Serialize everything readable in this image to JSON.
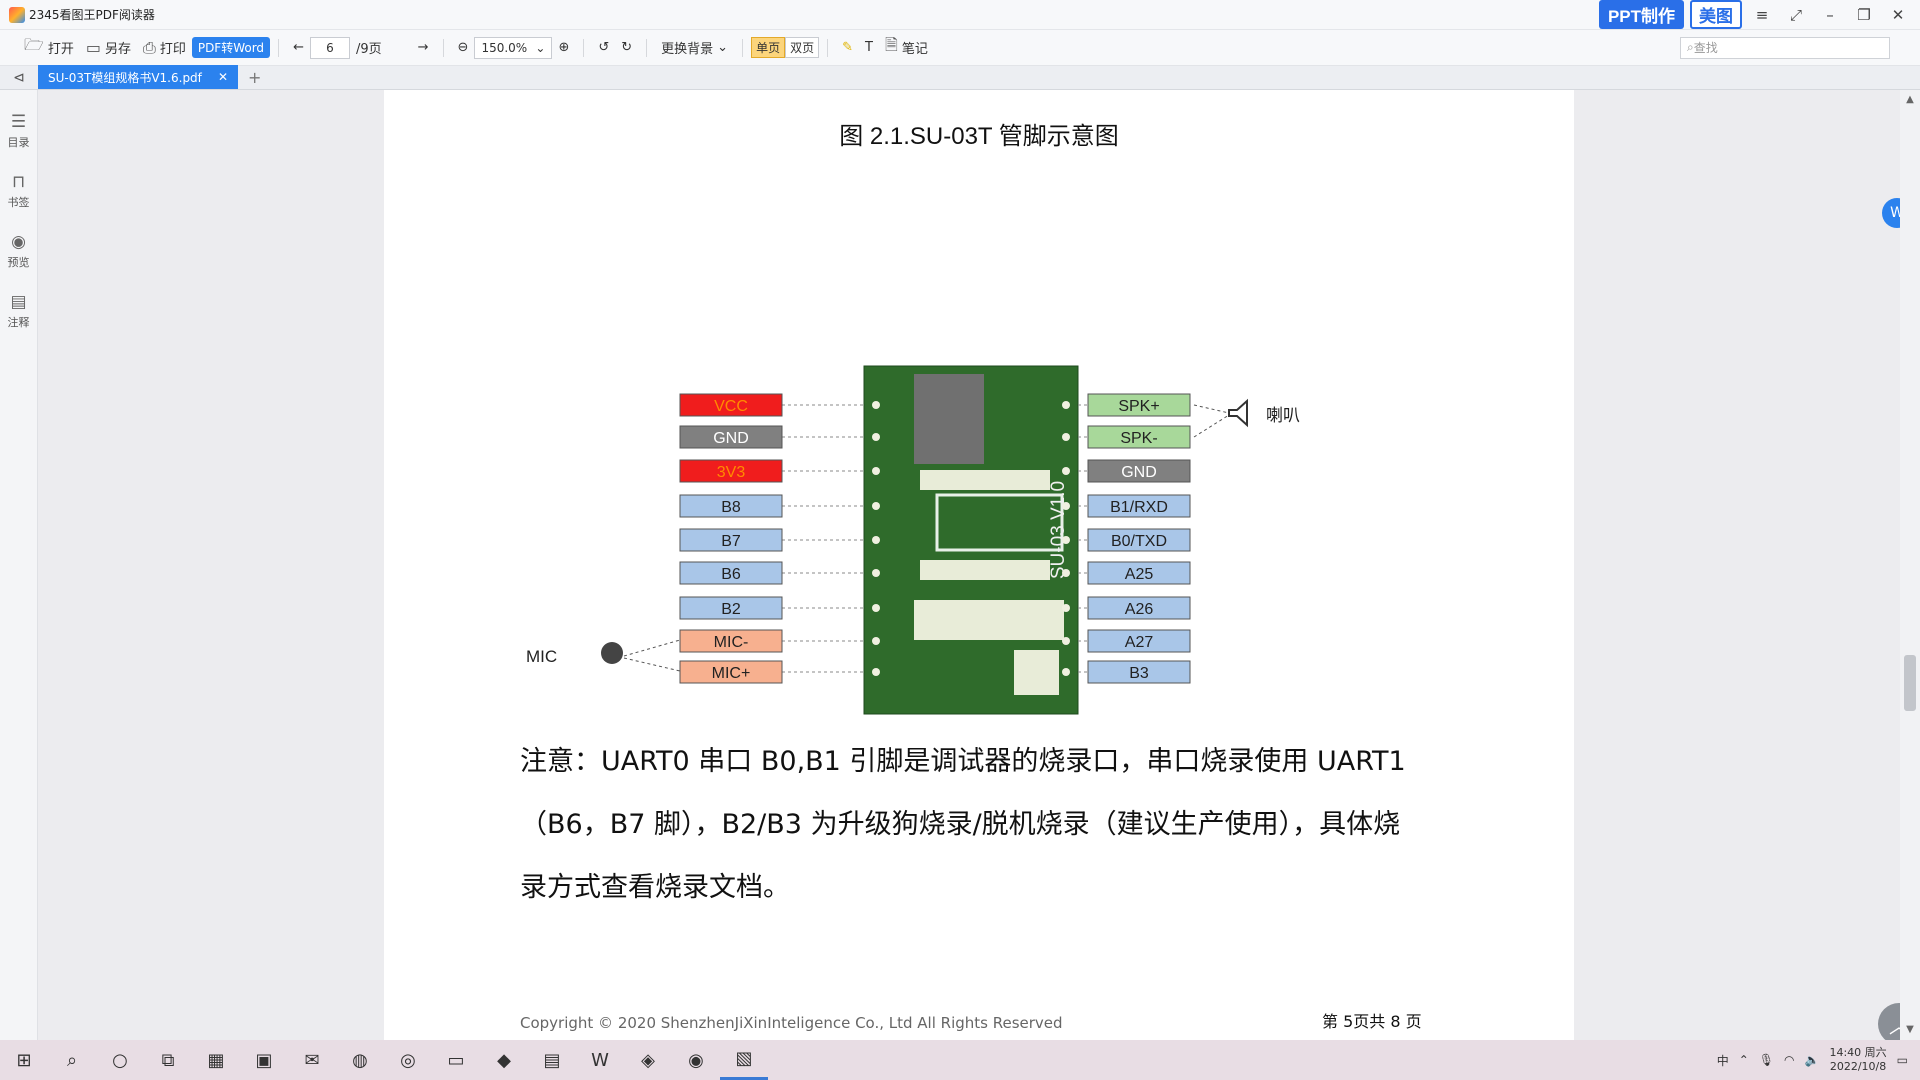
{
  "window": {
    "title": "2345看图王PDF阅读器",
    "badge_ppt": "PPT制作",
    "badge_meitu": "美图"
  },
  "toolbar": {
    "open": "打开",
    "saveas": "另存",
    "print": "打印",
    "pdf2word": "PDF转Word",
    "page_current": "6",
    "page_total": "/9页",
    "zoom": "150.0%",
    "background": "更换背景",
    "single": "单页",
    "double": "双页",
    "notes": "笔记",
    "search_placeholder": "查找"
  },
  "tab": {
    "filename": "SU-03T模组规格书V1.6.pdf"
  },
  "sidebar": {
    "items": [
      {
        "label": "目录",
        "icon": "toc-icon"
      },
      {
        "label": "书签",
        "icon": "bookmark-icon"
      },
      {
        "label": "预览",
        "icon": "eye-icon"
      },
      {
        "label": "注释",
        "icon": "comment-icon"
      }
    ]
  },
  "document": {
    "caption": "图 2.1.SU-03T 管脚示意图",
    "pins_left": [
      {
        "label": "VCC",
        "color": "#f01d1d",
        "text_color": "#ff8a00"
      },
      {
        "label": "GND",
        "color": "#808080",
        "text_color": "#ffffff"
      },
      {
        "label": "3V3",
        "color": "#f01d1d",
        "text_color": "#ff8a00"
      },
      {
        "label": "B8",
        "color": "#a9c6e8",
        "text_color": "#222222"
      },
      {
        "label": "B7",
        "color": "#a9c6e8",
        "text_color": "#222222"
      },
      {
        "label": "B6",
        "color": "#a9c6e8",
        "text_color": "#222222"
      },
      {
        "label": "B2",
        "color": "#a9c6e8",
        "text_color": "#222222"
      },
      {
        "label": "MIC-",
        "color": "#f7b08f",
        "text_color": "#222222"
      },
      {
        "label": "MIC+",
        "color": "#f7b08f",
        "text_color": "#222222"
      }
    ],
    "pins_right": [
      {
        "label": "SPK+",
        "color": "#a8d89a",
        "text_color": "#222222"
      },
      {
        "label": "SPK-",
        "color": "#a8d89a",
        "text_color": "#222222"
      },
      {
        "label": "GND",
        "color": "#808080",
        "text_color": "#ffffff"
      },
      {
        "label": "B1/RXD",
        "color": "#a9c6e8",
        "text_color": "#222222"
      },
      {
        "label": "B0/TXD",
        "color": "#a9c6e8",
        "text_color": "#222222"
      },
      {
        "label": "A25",
        "color": "#a9c6e8",
        "text_color": "#222222"
      },
      {
        "label": "A26",
        "color": "#a9c6e8",
        "text_color": "#222222"
      },
      {
        "label": "A27",
        "color": "#a9c6e8",
        "text_color": "#222222"
      },
      {
        "label": "B3",
        "color": "#a9c6e8",
        "text_color": "#222222"
      }
    ],
    "mic_label": "MIC",
    "speaker_label": "喇叭",
    "board_label": "SU-03 V1.0",
    "note_line1": "注意：UART0 串口 B0,B1 引脚是调试器的烧录口，串口烧录使用 UART1",
    "note_line2": "（B6，B7 脚），B2/B3 为升级狗烧录/脱机烧录（建议生产使用），具体烧",
    "note_line3": "录方式查看烧录文档。",
    "footer_left": "Copyright © 2020   ShenzhenJiXinInteligence Co., Ltd All Rights Reserved",
    "footer_right": "第 5页共 8 页"
  },
  "taskbar": {
    "time": "14:40 周六",
    "date": "2022/10/8",
    "ime": "中"
  }
}
